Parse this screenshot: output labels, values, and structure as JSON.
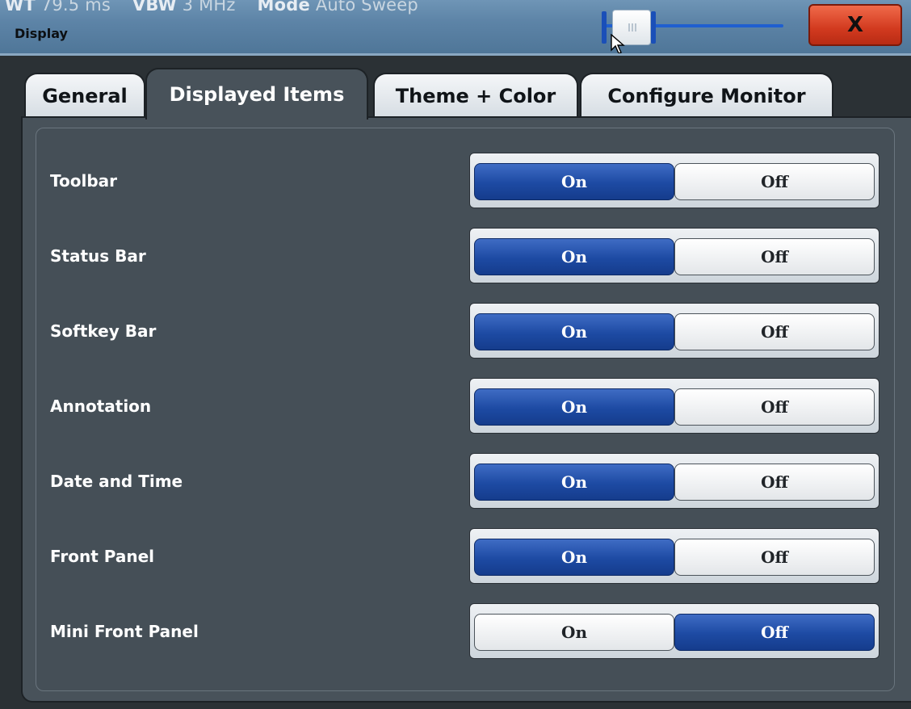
{
  "header": {
    "background_status": [
      {
        "label": "WT",
        "value": "79.5 ms"
      },
      {
        "label": "VBW",
        "value": "3 MHz"
      },
      {
        "label": "Mode",
        "value": "Auto Sweep"
      }
    ],
    "dialog_title": "Display",
    "close_label": "X"
  },
  "tabs": [
    {
      "label": "General",
      "active": false
    },
    {
      "label": "Displayed Items",
      "active": true
    },
    {
      "label": "Theme + Color",
      "active": false
    },
    {
      "label": "Configure Monitor",
      "active": false
    }
  ],
  "items": [
    {
      "label": "Toolbar",
      "on": "On",
      "off": "Off",
      "selected": "On"
    },
    {
      "label": "Status Bar",
      "on": "On",
      "off": "Off",
      "selected": "On"
    },
    {
      "label": "Softkey Bar",
      "on": "On",
      "off": "Off",
      "selected": "On"
    },
    {
      "label": "Annotation",
      "on": "On",
      "off": "Off",
      "selected": "On"
    },
    {
      "label": "Date and Time",
      "on": "On",
      "off": "Off",
      "selected": "On"
    },
    {
      "label": "Front Panel",
      "on": "On",
      "off": "Off",
      "selected": "On"
    },
    {
      "label": "Mini Front Panel",
      "on": "On",
      "off": "Off",
      "selected": "Off"
    }
  ],
  "colors": {
    "selected": "#1d4aa3",
    "close_button": "#d23a1f",
    "panel": "#48525a"
  }
}
